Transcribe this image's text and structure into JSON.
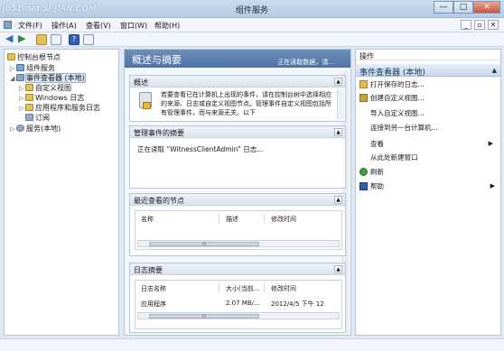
{
  "window": {
    "title": "组件服务",
    "watermark": "jb51.net SI JIAN.COM",
    "minimize": "—",
    "maximize": "□",
    "close": "✕"
  },
  "menu": {
    "items": [
      "文件(F)",
      "操作(A)",
      "查看(V)",
      "窗口(W)",
      "帮助(H)"
    ],
    "mdi": [
      "_",
      "▫",
      "✕"
    ]
  },
  "tree": {
    "items": [
      {
        "label": "控制台根节点",
        "icon_color": "#e3c15a"
      },
      {
        "label": "组件服务",
        "icon_color": "#7fa5d6"
      },
      {
        "label": "事件查看器 (本地)",
        "icon_color": "#8aa4c4"
      },
      {
        "label": "自定义视图",
        "icon_color": "#e3c15a"
      },
      {
        "label": "Windows 日志",
        "icon_color": "#e3c15a"
      },
      {
        "label": "应用程序和服务日志",
        "icon_color": "#e3c15a"
      },
      {
        "label": "订阅",
        "icon_color": "#9aa9bd"
      },
      {
        "label": "服务(本地)",
        "icon_color": "#9aa9bd"
      }
    ]
  },
  "center": {
    "title": "概述与摘要",
    "status": "正在读取数据，请...",
    "overview": {
      "header": "概述",
      "text": "若要查看已在计算机上出现的事件，请在控制台树中选择相应的来源、日志或自定义视图节点。管理事件自定义视图包括所有管理事件，而与来源无关。以下"
    },
    "admin_summary": {
      "header": "管理事件的摘要",
      "text": "正在读取 “WitnessClientAdmin” 日志..."
    },
    "recent_nodes": {
      "header": "最近查看的节点",
      "columns": [
        "名称",
        "描述",
        "修改时间"
      ]
    },
    "log_summary": {
      "header": "日志摘要",
      "columns": [
        "日志名称",
        "大小(当前...",
        "修改时间"
      ],
      "rows": [
        {
          "name": "应用程序",
          "size": "2.07 MB/...",
          "modified": "2012/4/5 下午 12"
        }
      ]
    },
    "scroll_grip": "III",
    "collapse_glyph": "▲"
  },
  "actions": {
    "header": "操作",
    "section": "事件查看器 (本地)",
    "items": [
      {
        "label": "打开保存的日志...",
        "icon": "folder-open-icon",
        "color": "#e3b84a"
      },
      {
        "label": "创建自定义视图...",
        "icon": "filter-icon",
        "color": "#c9a341"
      },
      {
        "label": "导入自定义视图...",
        "icon": "",
        "color": ""
      },
      {
        "label": "连接到另一台计算机...",
        "icon": "",
        "color": ""
      },
      {
        "label": "查看",
        "icon": "",
        "color": "",
        "submenu": "▶"
      },
      {
        "label": "从此处新建窗口",
        "icon": "",
        "color": ""
      },
      {
        "label": "刷新",
        "icon": "refresh-icon",
        "color": "#3fa048"
      },
      {
        "label": "帮助",
        "icon": "help-icon",
        "color": "#2f5fb5",
        "submenu": "▶"
      }
    ]
  }
}
